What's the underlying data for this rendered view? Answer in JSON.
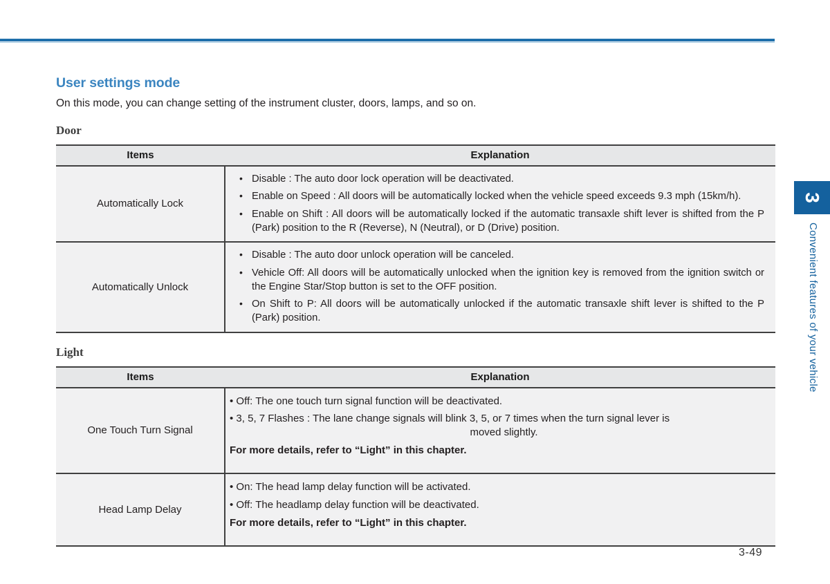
{
  "page": {
    "number": "3-49",
    "rule_color": "#1f6fab"
  },
  "side_tab": {
    "chapter_number": "3",
    "chapter_label": "Convenient features of your vehicle",
    "color": "#14619e"
  },
  "section": {
    "title": "User settings mode",
    "title_color": "#3b85c0",
    "intro": "On this mode, you can change setting of the instrument cluster, doors, lamps, and so on."
  },
  "tables": [
    {
      "caption": "Door",
      "headers": {
        "items": "Items",
        "explanation": "Explanation"
      },
      "rows": [
        {
          "item": "Automatically Lock",
          "bullets": [
            "Disable : The auto door lock operation will be deactivated.",
            "Enable on Speed : All doors will be automatically locked when the vehicle speed exceeds 9.3 mph (15km/h).",
            "Enable on Shift : All doors will be automatically locked if the automatic transaxle shift lever is shifted from the P (Park) position to the R (Reverse), N (Neutral), or D (Drive) position."
          ]
        },
        {
          "item": "Automatically Unlock",
          "bullets": [
            "Disable : The auto door unlock operation will be canceled.",
            "Vehicle Off: All doors will be automatically unlocked when the ignition key is removed from the ignition switch or the Engine Star/Stop button is set to the OFF position.",
            "On Shift to P: All doors will be automatically unlocked if the automatic transaxle shift lever is shifted to the P (Park) position."
          ]
        }
      ]
    },
    {
      "caption": "Light",
      "headers": {
        "items": "Items",
        "explanation": "Explanation"
      },
      "rows": [
        {
          "item": "One Touch Turn Signal",
          "lines": [
            "• Off: The one touch turn signal function will be deactivated.",
            "• 3, 5, 7 Flashes : The lane change signals will blink 3, 5, or 7 times when the turn signal lever is",
            "moved slightly."
          ],
          "note": "For more details, refer to “Light” in this chapter."
        },
        {
          "item": "Head Lamp Delay",
          "lines": [
            "• On: The head lamp delay function will be activated.",
            "• Off: The headlamp delay function will be deactivated."
          ],
          "note": "For more details, refer to “Light” in this chapter."
        }
      ]
    }
  ]
}
